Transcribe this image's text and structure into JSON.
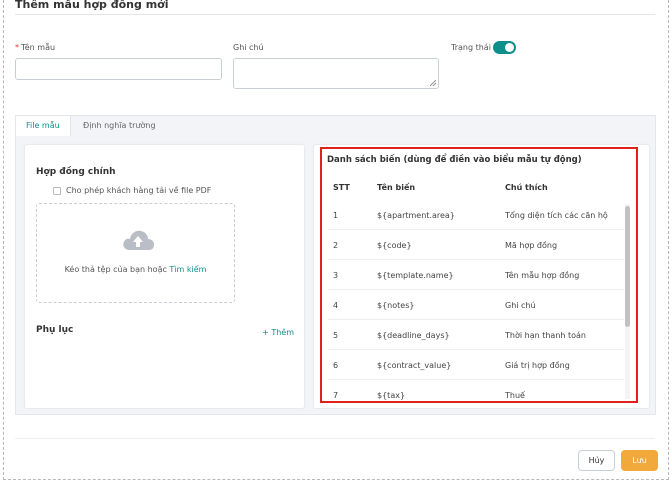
{
  "modal": {
    "title": "Thêm mẫu hợp đồng mới",
    "cancel_label": "Hủy",
    "save_label": "Lưu"
  },
  "form": {
    "name": {
      "required_mark": "*",
      "label": "Tên mẫu",
      "value": ""
    },
    "note": {
      "label": "Ghi chú",
      "value": ""
    },
    "status": {
      "label": "Trạng thái",
      "enabled": true
    }
  },
  "tabs": [
    {
      "label": "File mẫu",
      "active": true
    },
    {
      "label": "Định nghĩa trường",
      "active": false
    }
  ],
  "left_panel": {
    "main_contract_title": "Hợp đồng chính",
    "allow_pdf_label": "Cho phép khách hàng tải về file PDF",
    "drop_text": "Kéo thả tệp của bạn hoặc",
    "drop_link": "Tìm kiếm",
    "appendix_title": "Phụ lục",
    "add_label": "Thêm",
    "add_icon": "plus-icon"
  },
  "variables": {
    "title": "Danh sách biến (dùng để điền vào biểu mẫu tự động)",
    "columns": [
      "STT",
      "Tên biến",
      "Chú thích"
    ],
    "rows": [
      [
        "1",
        "${apartment.area}",
        "Tổng diện tích các căn hộ"
      ],
      [
        "2",
        "${code}",
        "Mã hợp đồng"
      ],
      [
        "3",
        "${template.name}",
        "Tên mẫu hợp đồng"
      ],
      [
        "4",
        "${notes}",
        "Ghi chú"
      ],
      [
        "5",
        "${deadline_days}",
        "Thời hạn thanh toán"
      ],
      [
        "6",
        "${contract_value}",
        "Giá trị hợp đồng"
      ],
      [
        "7",
        "${tax}",
        "Thuế"
      ]
    ]
  },
  "colors": {
    "accent": "#0f8f8c",
    "save": "#f2a93b",
    "highlight": "#e0201b"
  }
}
